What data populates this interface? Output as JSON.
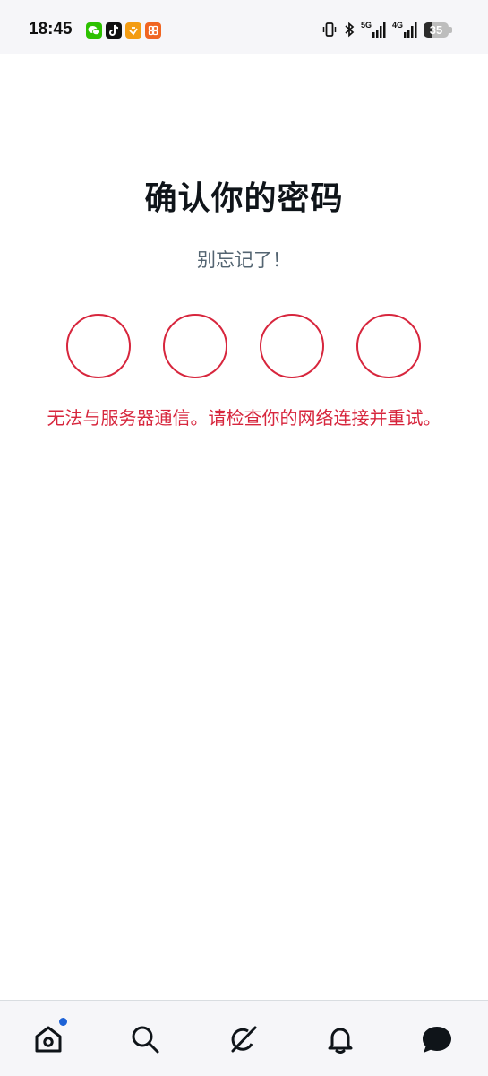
{
  "status_bar": {
    "time": "18:45",
    "battery_level": "35",
    "network_5g": "5G",
    "network_4g": "4G"
  },
  "main": {
    "title": "确认你的密码",
    "subtitle": "别忘记了！",
    "pin_length": 4,
    "error_message": "无法与服务器通信。请检查你的网络连接并重试。",
    "error_color": "#d7263d"
  },
  "bottom_nav": {
    "items": [
      {
        "icon": "home-icon",
        "has_badge": true
      },
      {
        "icon": "search-icon",
        "has_badge": false
      },
      {
        "icon": "grok-icon",
        "has_badge": false
      },
      {
        "icon": "bell-icon",
        "has_badge": false
      },
      {
        "icon": "messages-icon",
        "has_badge": false
      }
    ]
  },
  "colors": {
    "title": "#0f1419",
    "subtitle": "#536471",
    "badge": "#1d62d6"
  }
}
